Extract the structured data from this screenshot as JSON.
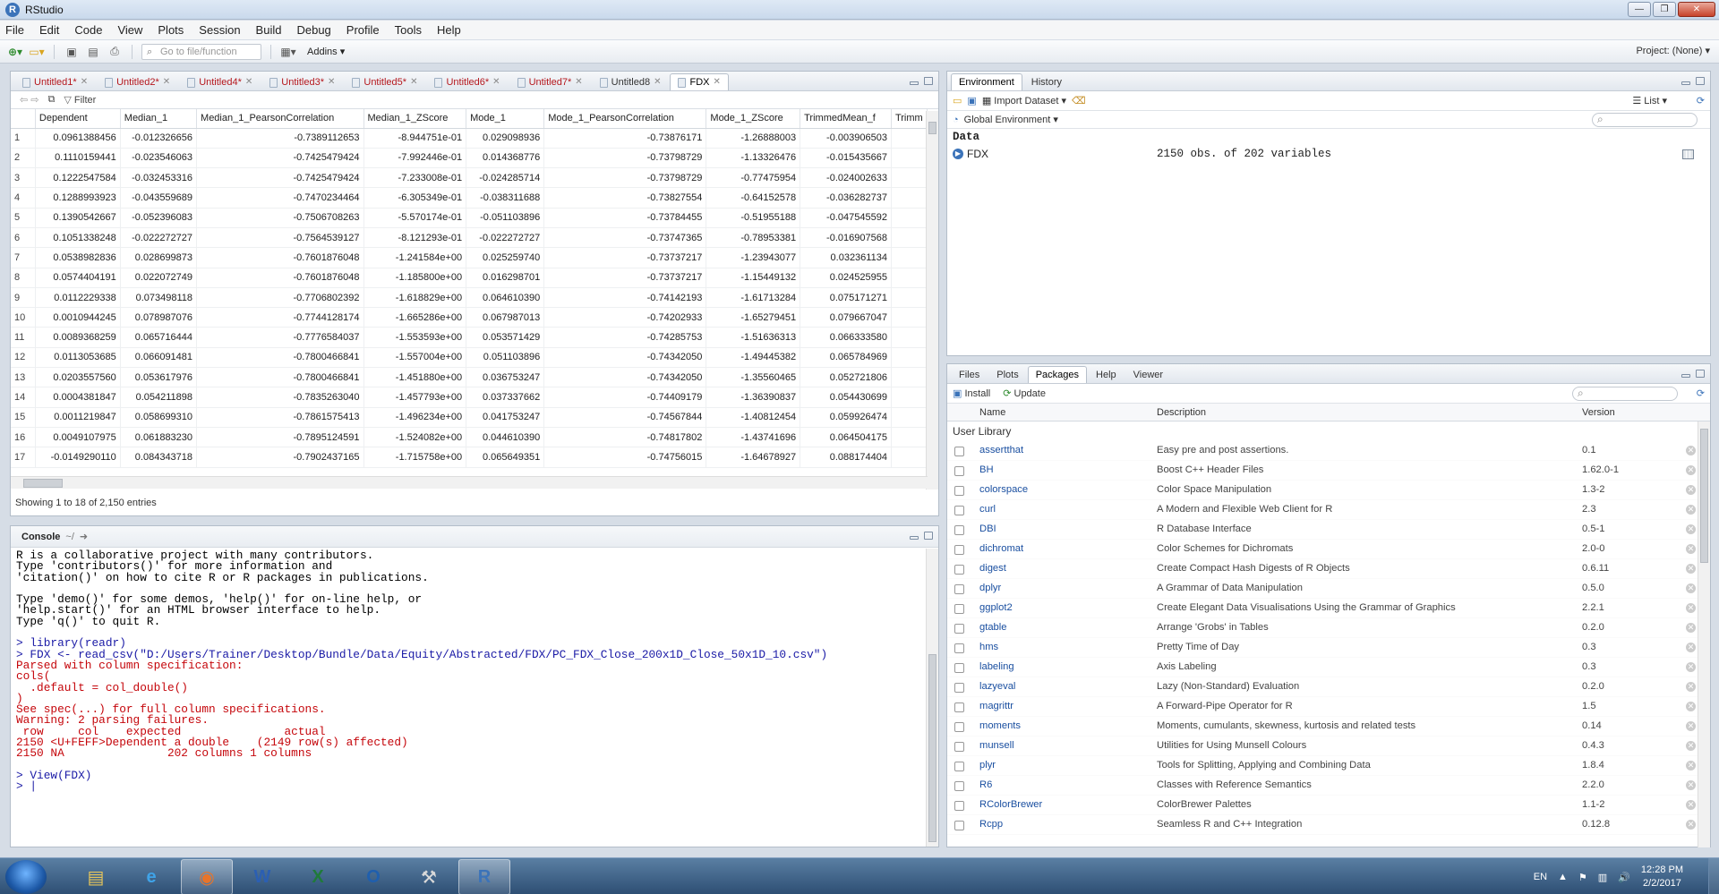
{
  "window": {
    "title": "RStudio",
    "controls": [
      "—",
      "❐",
      "✕"
    ]
  },
  "menu": [
    "File",
    "Edit",
    "Code",
    "View",
    "Plots",
    "Session",
    "Build",
    "Debug",
    "Profile",
    "Tools",
    "Help"
  ],
  "toolbar": {
    "goto_placeholder": "Go to file/function",
    "addins": "Addins ▾",
    "project": "Project: (None) ▾"
  },
  "source": {
    "tabs": [
      {
        "label": "Untitled1*",
        "modified": true
      },
      {
        "label": "Untitled2*",
        "modified": true
      },
      {
        "label": "Untitled4*",
        "modified": true
      },
      {
        "label": "Untitled3*",
        "modified": true
      },
      {
        "label": "Untitled5*",
        "modified": true
      },
      {
        "label": "Untitled6*",
        "modified": true
      },
      {
        "label": "Untitled7*",
        "modified": true
      },
      {
        "label": "Untitled8",
        "modified": false
      },
      {
        "label": "FDX",
        "modified": false,
        "active": true
      }
    ],
    "filter_label": "Filter",
    "columns": [
      "",
      "Dependent",
      "Median_1",
      "Median_1_PearsonCorrelation",
      "Median_1_ZScore",
      "Mode_1",
      "Mode_1_PearsonCorrelation",
      "Mode_1_ZScore",
      "TrimmedMean_f",
      "Trimm"
    ],
    "rows": [
      [
        "1",
        "0.0961388456",
        "-0.012326656",
        "-0.7389112653",
        "-8.944751e-01",
        "0.029098936",
        "-0.73876171",
        "-1.26888003",
        "-0.003906503"
      ],
      [
        "2",
        "0.1110159441",
        "-0.023546063",
        "-0.7425479424",
        "-7.992446e-01",
        "0.014368776",
        "-0.73798729",
        "-1.13326476",
        "-0.015435667"
      ],
      [
        "3",
        "0.1222547584",
        "-0.032453316",
        "-0.7425479424",
        "-7.233008e-01",
        "-0.024285714",
        "-0.73798729",
        "-0.77475954",
        "-0.024002633"
      ],
      [
        "4",
        "0.1288993923",
        "-0.043559689",
        "-0.7470234464",
        "-6.305349e-01",
        "-0.038311688",
        "-0.73827554",
        "-0.64152578",
        "-0.036282737"
      ],
      [
        "5",
        "0.1390542667",
        "-0.052396083",
        "-0.7506708263",
        "-5.570174e-01",
        "-0.051103896",
        "-0.73784455",
        "-0.51955188",
        "-0.047545592"
      ],
      [
        "6",
        "0.1051338248",
        "-0.022272727",
        "-0.7564539127",
        "-8.121293e-01",
        "-0.022272727",
        "-0.73747365",
        "-0.78953381",
        "-0.016907568"
      ],
      [
        "7",
        "0.0538982836",
        "0.028699873",
        "-0.7601876048",
        "-1.241584e+00",
        "0.025259740",
        "-0.73737217",
        "-1.23943077",
        "0.032361134"
      ],
      [
        "8",
        "0.0574404191",
        "0.022072749",
        "-0.7601876048",
        "-1.185800e+00",
        "0.016298701",
        "-0.73737217",
        "-1.15449132",
        "0.024525955"
      ],
      [
        "9",
        "0.0112229338",
        "0.073498118",
        "-0.7706802392",
        "-1.618829e+00",
        "0.064610390",
        "-0.74142193",
        "-1.61713284",
        "0.075171271"
      ],
      [
        "10",
        "0.0010944245",
        "0.078987076",
        "-0.7744128174",
        "-1.665286e+00",
        "0.067987013",
        "-0.74202933",
        "-1.65279451",
        "0.079667047"
      ],
      [
        "11",
        "0.0089368259",
        "0.065716444",
        "-0.7776584037",
        "-1.553593e+00",
        "0.053571429",
        "-0.74285753",
        "-1.51636313",
        "0.066333580"
      ],
      [
        "12",
        "0.0113053685",
        "0.066091481",
        "-0.7800466841",
        "-1.557004e+00",
        "0.051103896",
        "-0.74342050",
        "-1.49445382",
        "0.065784969"
      ],
      [
        "13",
        "0.0203557560",
        "0.053617976",
        "-0.7800466841",
        "-1.451880e+00",
        "0.036753247",
        "-0.74342050",
        "-1.35560465",
        "0.052721806"
      ],
      [
        "14",
        "0.0004381847",
        "0.054211898",
        "-0.7835263040",
        "-1.457793e+00",
        "0.037337662",
        "-0.74409179",
        "-1.36390837",
        "0.054430699"
      ],
      [
        "15",
        "0.0011219847",
        "0.058699310",
        "-0.7861575413",
        "-1.496234e+00",
        "0.041753247",
        "-0.74567844",
        "-1.40812454",
        "0.059926474"
      ],
      [
        "16",
        "0.0049107975",
        "0.061883230",
        "-0.7895124591",
        "-1.524082e+00",
        "0.044610390",
        "-0.74817802",
        "-1.43741696",
        "0.064504175"
      ],
      [
        "17",
        "-0.0149290110",
        "0.084343718",
        "-0.7902437165",
        "-1.715758e+00",
        "0.065649351",
        "-0.74756015",
        "-1.64678927",
        "0.088174404"
      ]
    ],
    "showing": "Showing 1 to 18 of 2,150 entries"
  },
  "console": {
    "title": "Console",
    "path": "~/",
    "lines": [
      {
        "t": "R is a collaborative project with many contributors.",
        "c": ""
      },
      {
        "t": "Type 'contributors()' for more information and",
        "c": ""
      },
      {
        "t": "'citation()' on how to cite R or R packages in publications.",
        "c": ""
      },
      {
        "t": "",
        "c": ""
      },
      {
        "t": "Type 'demo()' for some demos, 'help()' for on-line help, or",
        "c": ""
      },
      {
        "t": "'help.start()' for an HTML browser interface to help.",
        "c": ""
      },
      {
        "t": "Type 'q()' to quit R.",
        "c": ""
      },
      {
        "t": "",
        "c": ""
      },
      {
        "t": "> library(readr)",
        "c": "cmd"
      },
      {
        "t": "> FDX <- read_csv(\"D:/Users/Trainer/Desktop/Bundle/Data/Equity/Abstracted/FDX/PC_FDX_Close_200x1D_Close_50x1D_10.csv\")",
        "c": "cmd"
      },
      {
        "t": "Parsed with column specification:",
        "c": "err"
      },
      {
        "t": "cols(",
        "c": "err"
      },
      {
        "t": "  .default = col_double()",
        "c": "err"
      },
      {
        "t": ")",
        "c": "err"
      },
      {
        "t": "See spec(...) for full column specifications.",
        "c": "err"
      },
      {
        "t": "Warning: 2 parsing failures.",
        "c": "err"
      },
      {
        "t": " row     col    expected               actual",
        "c": "err"
      },
      {
        "t": "2150 <U+FEFF>Dependent a double    (2149 row(s) affected)",
        "c": "err"
      },
      {
        "t": "2150 NA               202 columns 1 columns",
        "c": "err"
      },
      {
        "t": "",
        "c": ""
      },
      {
        "t": "> View(FDX)",
        "c": "cmd"
      },
      {
        "t": "> |",
        "c": "cmd"
      }
    ]
  },
  "environment": {
    "tabs": [
      "Environment",
      "History"
    ],
    "import_label": "Import Dataset ▾",
    "list_label": "List ▾",
    "scope": "Global Environment ▾",
    "section": "Data",
    "objects": [
      {
        "name": "FDX",
        "value": "2150 obs. of 202 variables"
      }
    ]
  },
  "files": {
    "tabs": [
      "Files",
      "Plots",
      "Packages",
      "Help",
      "Viewer"
    ],
    "install_label": "Install",
    "update_label": "Update",
    "col_name": "Name",
    "col_desc": "Description",
    "col_ver": "Version",
    "user_library": "User Library",
    "packages": [
      {
        "name": "assertthat",
        "desc": "Easy pre and post assertions.",
        "ver": "0.1"
      },
      {
        "name": "BH",
        "desc": "Boost C++ Header Files",
        "ver": "1.62.0-1"
      },
      {
        "name": "colorspace",
        "desc": "Color Space Manipulation",
        "ver": "1.3-2"
      },
      {
        "name": "curl",
        "desc": "A Modern and Flexible Web Client for R",
        "ver": "2.3"
      },
      {
        "name": "DBI",
        "desc": "R Database Interface",
        "ver": "0.5-1"
      },
      {
        "name": "dichromat",
        "desc": "Color Schemes for Dichromats",
        "ver": "2.0-0"
      },
      {
        "name": "digest",
        "desc": "Create Compact Hash Digests of R Objects",
        "ver": "0.6.11"
      },
      {
        "name": "dplyr",
        "desc": "A Grammar of Data Manipulation",
        "ver": "0.5.0"
      },
      {
        "name": "ggplot2",
        "desc": "Create Elegant Data Visualisations Using the Grammar of Graphics",
        "ver": "2.2.1"
      },
      {
        "name": "gtable",
        "desc": "Arrange 'Grobs' in Tables",
        "ver": "0.2.0"
      },
      {
        "name": "hms",
        "desc": "Pretty Time of Day",
        "ver": "0.3"
      },
      {
        "name": "labeling",
        "desc": "Axis Labeling",
        "ver": "0.3"
      },
      {
        "name": "lazyeval",
        "desc": "Lazy (Non-Standard) Evaluation",
        "ver": "0.2.0"
      },
      {
        "name": "magrittr",
        "desc": "A Forward-Pipe Operator for R",
        "ver": "1.5"
      },
      {
        "name": "moments",
        "desc": "Moments, cumulants, skewness, kurtosis and related tests",
        "ver": "0.14"
      },
      {
        "name": "munsell",
        "desc": "Utilities for Using Munsell Colours",
        "ver": "0.4.3"
      },
      {
        "name": "plyr",
        "desc": "Tools for Splitting, Applying and Combining Data",
        "ver": "1.8.4"
      },
      {
        "name": "R6",
        "desc": "Classes with Reference Semantics",
        "ver": "2.2.0"
      },
      {
        "name": "RColorBrewer",
        "desc": "ColorBrewer Palettes",
        "ver": "1.1-2"
      },
      {
        "name": "Rcpp",
        "desc": "Seamless R and C++ Integration",
        "ver": "0.12.8"
      }
    ]
  },
  "taskbar": {
    "apps": [
      {
        "icon": "folder-icon",
        "glyph": "▤",
        "color": "#e8c65a"
      },
      {
        "icon": "ie-icon",
        "glyph": "e",
        "color": "#3fa3e8"
      },
      {
        "icon": "firefox-icon",
        "glyph": "◉",
        "color": "#e8742a",
        "active": true
      },
      {
        "icon": "word-icon",
        "glyph": "W",
        "color": "#2b5fb3"
      },
      {
        "icon": "excel-icon",
        "glyph": "X",
        "color": "#1f7a3a"
      },
      {
        "icon": "outlook-icon",
        "glyph": "O",
        "color": "#1f5fae"
      },
      {
        "icon": "tools-icon",
        "glyph": "⚒",
        "color": "#d9d9d9"
      },
      {
        "icon": "r-icon",
        "glyph": "R",
        "color": "#3b73b9",
        "active": true
      }
    ],
    "lang": "EN",
    "time": "12:28 PM",
    "date": "2/2/2017"
  }
}
